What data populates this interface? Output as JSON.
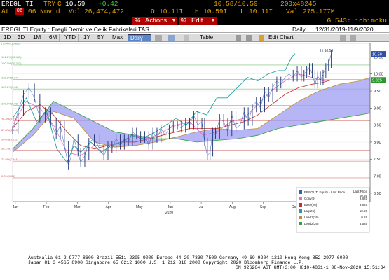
{
  "header": {
    "ticker": "EREGL TI",
    "currency": "TRY",
    "price_prefix": "C",
    "price": "10.59",
    "change": "+0.42",
    "bid_ask": "10.58/10.59",
    "size": "200x48245",
    "at_label": "At",
    "time_flag": "06",
    "date": "06 Nov d",
    "volume_label": "Vol",
    "volume": "26,474,472",
    "open_label": "O",
    "open": "10.11I",
    "high_label": "H",
    "high": "10.59I",
    "low_label": "L",
    "low": "10.11I",
    "value_label": "Val",
    "value": "275.177M"
  },
  "toolbar": {
    "actions_num": "96",
    "actions_label": "Actions",
    "edit_num": "97",
    "edit_label": "Edit",
    "function_code": "G 543: ichimoku"
  },
  "title_bar": {
    "title": "EREGL TI Equity : Eregli Demir ve Celik Fabrikalari TAS",
    "frequency": "Daily",
    "date_range": "12/31/2019-11/9/2020"
  },
  "range_tabs": [
    "1D",
    "3D",
    "1M",
    "6M",
    "YTD",
    "1Y",
    "5Y",
    "Max"
  ],
  "period_select": "Daily",
  "table_label": "Table",
  "edit_chart_label": "Edit Chart",
  "chart_data": {
    "type": "line",
    "title": "EREGL TI Equity",
    "legend_header": "Last Price",
    "legend_position": "bottom-right",
    "x_months": [
      "Jan",
      "Feb",
      "Mar",
      "Apr",
      "May",
      "Jun",
      "Jul",
      "Aug",
      "Sep",
      "Oct",
      "Nov",
      "Dec"
    ],
    "x_year": "2020",
    "ylim": [
      6.25,
      10.9
    ],
    "y_ticks": [
      "10.50",
      "10.00",
      "9.50",
      "9.00",
      "8.50",
      "8.00",
      "7.50",
      "7.00",
      "6.50"
    ],
    "fib_levels": [
      {
        "label": "(76.4%)10.852",
        "value": 10.852
      },
      {
        "label": "161.8%(10.443)",
        "value": 10.443
      },
      {
        "label": "150.0%(10.263)",
        "value": 10.263
      },
      {
        "label": "138.2%(9.84)",
        "value": 9.84
      },
      {
        "label": "123.6%(9.56)",
        "value": 9.56
      },
      {
        "label": "100.0%(9.08)",
        "value": 9.08
      },
      {
        "label": "76.4%(8.63)",
        "value": 8.63
      },
      {
        "label": "61.8%(8.303)",
        "value": 8.303
      },
      {
        "label": "50.0%(8.032)",
        "value": 8.032
      },
      {
        "label": "38.2%(7.762)",
        "value": 7.762
      },
      {
        "label": "23.6%(7.441)",
        "value": 7.441
      },
      {
        "label": "0.0%(6.95)",
        "value": 6.95
      }
    ],
    "hi_label": "Hi  10.59",
    "last_price_tag": "10.59",
    "conv_tag": "9.825",
    "series": [
      {
        "name": "EREGL TI Equity - Last Price",
        "value": "10.59",
        "color": "#3060c0"
      },
      {
        "name": "Conv(9)",
        "value": "9.825",
        "color": "#e070c0"
      },
      {
        "name": "Base(26)",
        "value": "9.825",
        "color": "#c03030"
      },
      {
        "name": "Lag(26)",
        "value": "10.59",
        "color": "#20a0a0"
      },
      {
        "name": "Lead1(26)",
        "value": "9.19",
        "color": "#c09030"
      },
      {
        "name": "Lead2(26)",
        "value": "8.535",
        "color": "#30a040"
      }
    ],
    "price": [
      [
        0,
        8.35
      ],
      [
        8,
        8.9
      ],
      [
        16,
        9.4
      ],
      [
        24,
        9.6
      ],
      [
        32,
        9.3
      ],
      [
        40,
        8.7
      ],
      [
        48,
        8.9
      ],
      [
        56,
        8.6
      ],
      [
        64,
        8.2
      ],
      [
        70,
        8.5
      ],
      [
        76,
        7.9
      ],
      [
        82,
        7.3
      ],
      [
        86,
        7.6
      ],
      [
        90,
        8.1
      ],
      [
        96,
        7.7
      ],
      [
        100,
        7.4
      ],
      [
        106,
        7.6
      ],
      [
        112,
        8.0
      ],
      [
        120,
        8.1
      ],
      [
        128,
        7.8
      ],
      [
        134,
        7.6
      ],
      [
        140,
        7.9
      ],
      [
        146,
        7.8
      ],
      [
        152,
        8.1
      ],
      [
        158,
        7.9
      ],
      [
        164,
        8.1
      ],
      [
        170,
        8.0
      ],
      [
        176,
        8.3
      ],
      [
        182,
        8.2
      ],
      [
        188,
        8.1
      ],
      [
        194,
        8.2
      ],
      [
        200,
        7.9
      ],
      [
        206,
        8.3
      ],
      [
        212,
        8.1
      ],
      [
        218,
        8.4
      ],
      [
        224,
        8.2
      ],
      [
        230,
        8.4
      ],
      [
        236,
        8.5
      ],
      [
        242,
        8.5
      ],
      [
        248,
        8.4
      ],
      [
        254,
        8.6
      ],
      [
        260,
        8.5
      ],
      [
        266,
        8.8
      ],
      [
        272,
        8.5
      ],
      [
        278,
        8.6
      ],
      [
        282,
        8.0
      ],
      [
        286,
        7.6
      ],
      [
        290,
        7.7
      ],
      [
        294,
        8.3
      ],
      [
        298,
        8.2
      ],
      [
        304,
        8.7
      ],
      [
        310,
        8.6
      ],
      [
        316,
        8.3
      ],
      [
        322,
        8.8
      ],
      [
        328,
        8.4
      ],
      [
        334,
        8.5
      ],
      [
        340,
        8.9
      ],
      [
        346,
        8.6
      ],
      [
        352,
        9.0
      ],
      [
        358,
        9.2
      ],
      [
        364,
        9.0
      ],
      [
        370,
        9.5
      ],
      [
        376,
        9.3
      ],
      [
        382,
        9.6
      ],
      [
        388,
        9.8
      ],
      [
        394,
        9.7
      ],
      [
        400,
        9.9
      ],
      [
        406,
        10.0
      ],
      [
        412,
        9.9
      ],
      [
        418,
        10.1
      ],
      [
        424,
        9.9
      ],
      [
        428,
        10.0
      ],
      [
        432,
        10.1
      ],
      [
        436,
        10.2
      ],
      [
        440,
        10.0
      ],
      [
        444,
        9.7
      ],
      [
        448,
        9.95
      ],
      [
        452,
        9.8
      ],
      [
        456,
        10.0
      ],
      [
        460,
        10.2
      ],
      [
        464,
        10.3
      ],
      [
        468,
        10.59
      ]
    ],
    "conv": [
      [
        0,
        8.5
      ],
      [
        20,
        9.2
      ],
      [
        40,
        9.0
      ],
      [
        60,
        8.5
      ],
      [
        80,
        7.7
      ],
      [
        100,
        7.6
      ],
      [
        120,
        7.9
      ],
      [
        140,
        7.9
      ],
      [
        160,
        8.0
      ],
      [
        180,
        8.2
      ],
      [
        200,
        8.1
      ],
      [
        220,
        8.3
      ],
      [
        240,
        8.5
      ],
      [
        260,
        8.6
      ],
      [
        280,
        8.2
      ],
      [
        300,
        8.3
      ],
      [
        320,
        8.6
      ],
      [
        340,
        8.7
      ],
      [
        360,
        9.1
      ],
      [
        380,
        9.5
      ],
      [
        400,
        9.8
      ],
      [
        420,
        10.0
      ],
      [
        440,
        9.9
      ],
      [
        455,
        9.8
      ],
      [
        468,
        9.825
      ]
    ],
    "base": [
      [
        0,
        8.4
      ],
      [
        20,
        8.9
      ],
      [
        40,
        9.1
      ],
      [
        60,
        8.8
      ],
      [
        80,
        8.3
      ],
      [
        100,
        7.9
      ],
      [
        120,
        7.8
      ],
      [
        140,
        7.9
      ],
      [
        160,
        8.0
      ],
      [
        180,
        8.0
      ],
      [
        200,
        8.1
      ],
      [
        220,
        8.2
      ],
      [
        240,
        8.3
      ],
      [
        260,
        8.4
      ],
      [
        280,
        8.4
      ],
      [
        300,
        8.4
      ],
      [
        320,
        8.5
      ],
      [
        340,
        8.6
      ],
      [
        360,
        8.8
      ],
      [
        380,
        9.1
      ],
      [
        400,
        9.4
      ],
      [
        420,
        9.6
      ],
      [
        440,
        9.7
      ],
      [
        455,
        9.75
      ],
      [
        468,
        9.825
      ]
    ],
    "lag": [
      [
        0,
        8.7
      ],
      [
        20,
        9.3
      ],
      [
        35,
        8.6
      ],
      [
        50,
        8.9
      ],
      [
        65,
        7.8
      ],
      [
        80,
        7.4
      ],
      [
        90,
        7.9
      ],
      [
        100,
        7.7
      ],
      [
        115,
        8.0
      ],
      [
        130,
        7.7
      ],
      [
        145,
        7.9
      ],
      [
        160,
        8.0
      ],
      [
        175,
        8.2
      ],
      [
        190,
        8.1
      ],
      [
        210,
        8.3
      ],
      [
        225,
        8.5
      ],
      [
        240,
        8.7
      ],
      [
        255,
        8.5
      ],
      [
        270,
        8.9
      ],
      [
        285,
        8.8
      ],
      [
        300,
        9.3
      ],
      [
        315,
        9.3
      ],
      [
        330,
        9.6
      ],
      [
        345,
        9.9
      ],
      [
        360,
        9.8
      ],
      [
        375,
        10.0
      ],
      [
        390,
        10.1
      ],
      [
        400,
        10.1
      ],
      [
        410,
        10.5
      ],
      [
        415,
        10.6
      ]
    ],
    "lead1": [
      [
        0,
        7.7
      ],
      [
        30,
        8.2
      ],
      [
        60,
        8.9
      ],
      [
        90,
        8.7
      ],
      [
        120,
        8.0
      ],
      [
        150,
        7.85
      ],
      [
        180,
        7.9
      ],
      [
        210,
        8.0
      ],
      [
        240,
        8.15
      ],
      [
        270,
        8.3
      ],
      [
        300,
        8.4
      ],
      [
        330,
        8.35
      ],
      [
        360,
        8.4
      ],
      [
        390,
        8.8
      ],
      [
        420,
        9.2
      ],
      [
        450,
        9.5
      ],
      [
        480,
        9.7
      ],
      [
        510,
        9.8
      ],
      [
        525,
        9.9
      ]
    ],
    "lead2": [
      [
        0,
        7.8
      ],
      [
        30,
        8.4
      ],
      [
        60,
        9.2
      ],
      [
        90,
        8.9
      ],
      [
        120,
        8.6
      ],
      [
        150,
        8.3
      ],
      [
        180,
        8.2
      ],
      [
        210,
        8.1
      ],
      [
        240,
        8.1
      ],
      [
        270,
        8.0
      ],
      [
        300,
        8.05
      ],
      [
        330,
        8.1
      ],
      [
        360,
        8.2
      ],
      [
        390,
        8.4
      ],
      [
        420,
        8.5
      ],
      [
        450,
        8.6
      ],
      [
        480,
        8.7
      ],
      [
        510,
        8.8
      ],
      [
        525,
        8.85
      ]
    ]
  },
  "footer": {
    "line1": "Australia 61 2 9777 8600 Brazil 5511 2395 9000 Europe 44 20 7330 7500 Germany 49 69 9204 1210 Hong Kong 852 2977 6000",
    "line2": "Japan 81 3 4565 8900         Singapore 65 6212 1000       U.S. 1 212 318 2000          Copyright 2020 Bloomberg Finance L.P.",
    "line3": "SN 926264 AST  GMT+3:00 H810-4831-1 08-Nov-2020 15:51:34"
  }
}
